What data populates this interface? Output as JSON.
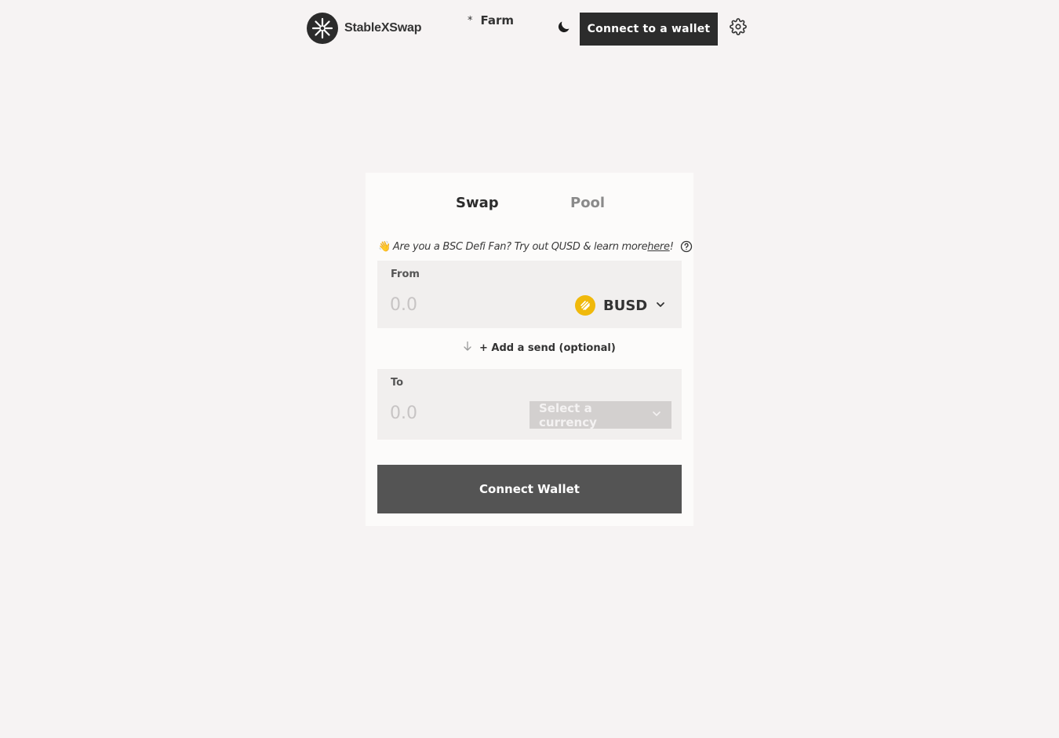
{
  "header": {
    "brand": "StableXSwap",
    "nav_farm_prefix": "*",
    "nav_farm_label": "Farm",
    "connect_label": "Connect to a wallet",
    "icons": {
      "logo": "logo-icon",
      "theme": "moon-icon",
      "settings": "gear-icon"
    }
  },
  "tabs": [
    {
      "label": "Swap",
      "active": true
    },
    {
      "label": "Pool",
      "active": false
    }
  ],
  "promo": {
    "emoji": "👋",
    "text": "Are you a BSC Defi Fan? Try out QUSD & learn more ",
    "link": "here",
    "suffix": "!"
  },
  "from": {
    "label": "From",
    "placeholder": "0.0",
    "token": "BUSD",
    "token_color": "#f0b90b"
  },
  "add_send": {
    "label": "+ Add a send (optional)"
  },
  "to": {
    "label": "To",
    "placeholder": "0.0",
    "select_label": "Select a currency"
  },
  "connect_wallet_label": "Connect Wallet",
  "colors": {
    "background": "#f6f3f3",
    "card": "#fcfbfa",
    "primary_button": "#2c2c2c",
    "connect_wallet_button": "#545454"
  }
}
